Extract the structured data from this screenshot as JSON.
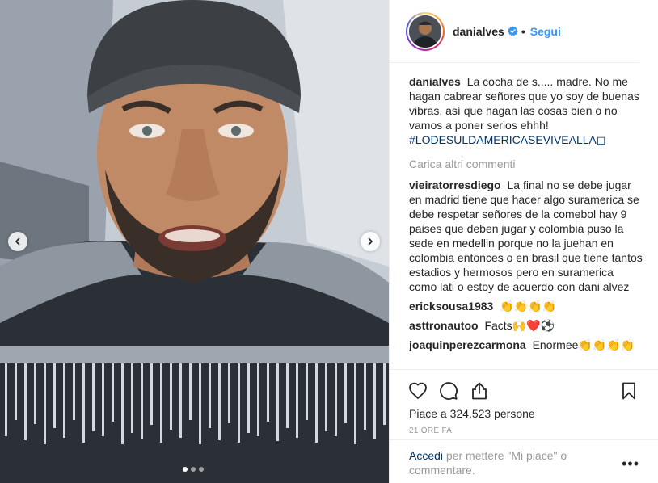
{
  "post": {
    "username": "danialves",
    "follow_label": "Segui",
    "separator": "•"
  },
  "caption": {
    "user": "danialves",
    "text": "La cocha de s..... madre. No me hagan cabrear señores que yo soy de buenas vibras, así que hagan las cosas bien o no vamos a poner serios ehhh!",
    "hashtag": "#LODESULDAMERICASEVIVEALLA◻"
  },
  "load_more_label": "Carica altri commenti",
  "comments": [
    {
      "user": "vieiratorresdiego",
      "text": "La final no se debe jugar en madrid tiene que hacer algo suramerica se debe respetar señores de la comebol hay 9 paises que deben jugar y colombia puso la sede en medellin porque no la juehan en colombia entonces o en brasil que tiene tantos estadios y hermosos pero en suramerica como lati o estoy de acuerdo con dani alvez"
    },
    {
      "user": "ericksousa1983",
      "text": "👏👏👏👏"
    },
    {
      "user": "asttronautoo",
      "text": "Facts🙌❤️⚽"
    },
    {
      "user": "joaquinperezcarmona",
      "text": "Enormee👏👏👏👏"
    }
  ],
  "likes_label": "Piace a 324.523 persone",
  "time_label": "21 ORE FA",
  "footer": {
    "login_label": "Accedi",
    "rest_label": " per mettere \"Mi piace\" o commentare.",
    "more_label": "•••"
  },
  "carousel": {
    "slide_count": 3,
    "active_index": 0
  },
  "colors": {
    "link": "#3897f0",
    "hashtag": "#003569",
    "muted": "#999999",
    "text": "#262626"
  },
  "icons": {
    "like": "heart-icon",
    "comment": "comment-icon",
    "share": "share-icon",
    "save": "bookmark-icon",
    "verified": "verified-badge-icon",
    "prev": "chevron-left-icon",
    "next": "chevron-right-icon"
  }
}
